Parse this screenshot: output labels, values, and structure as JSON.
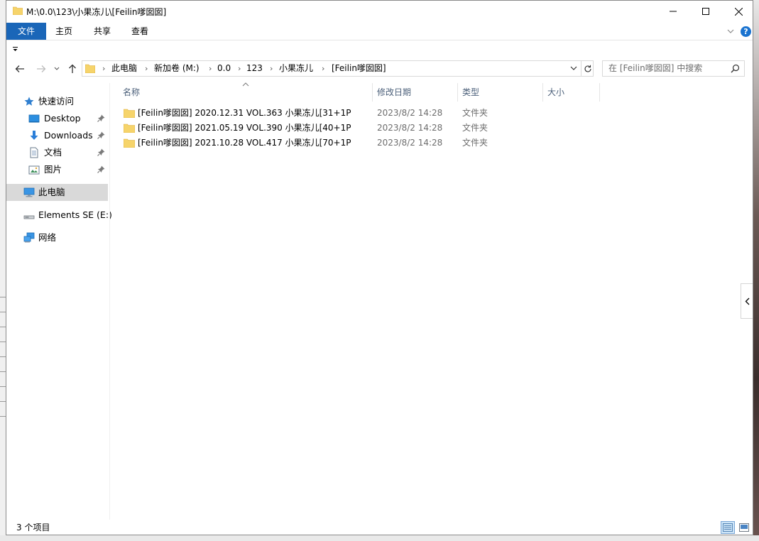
{
  "window": {
    "title": "M:\\0.0\\123\\小果冻儿\\[Feilin嗲囡囡]"
  },
  "ribbon": {
    "tabs": {
      "file": "文件",
      "home": "主页",
      "share": "共享",
      "view": "查看"
    }
  },
  "address": {
    "crumbs": [
      "此电脑",
      "新加卷 (M:)",
      "0.0",
      "123",
      "小果冻儿",
      "[Feilin嗲囡囡]"
    ],
    "separator": "›"
  },
  "search": {
    "placeholder": "在 [Feilin嗲囡囡] 中搜索"
  },
  "nav": {
    "items": [
      {
        "label": "快速访问",
        "icon": "star-icon"
      },
      {
        "label": "Desktop",
        "icon": "desktop-icon"
      },
      {
        "label": "Downloads",
        "icon": "download-icon"
      },
      {
        "label": "文档",
        "icon": "document-icon"
      },
      {
        "label": "图片",
        "icon": "pictures-icon"
      },
      {
        "label": "此电脑",
        "icon": "computer-icon"
      },
      {
        "label": "Elements SE (E:)",
        "icon": "drive-icon"
      },
      {
        "label": "网络",
        "icon": "network-icon"
      }
    ]
  },
  "columns": {
    "name": "名称",
    "date": "修改日期",
    "type": "类型",
    "size": "大小"
  },
  "files": [
    {
      "name": "[Feilin嗲囡囡] 2020.12.31 VOL.363 小果冻儿[31+1P",
      "date": "2023/8/2 14:28",
      "type": "文件夹"
    },
    {
      "name": "[Feilin嗲囡囡] 2021.05.19 VOL.390 小果冻儿[40+1P",
      "date": "2023/8/2 14:28",
      "type": "文件夹"
    },
    {
      "name": "[Feilin嗲囡囡] 2021.10.28 VOL.417 小果冻儿[70+1P",
      "date": "2023/8/2 14:28",
      "type": "文件夹"
    }
  ],
  "status": {
    "count": "3 个项目"
  },
  "help": {
    "label": "?"
  },
  "colors": {
    "accent": "#1a66b8",
    "folder": "#f6d46b",
    "selected_nav": "#d9d9d9"
  }
}
